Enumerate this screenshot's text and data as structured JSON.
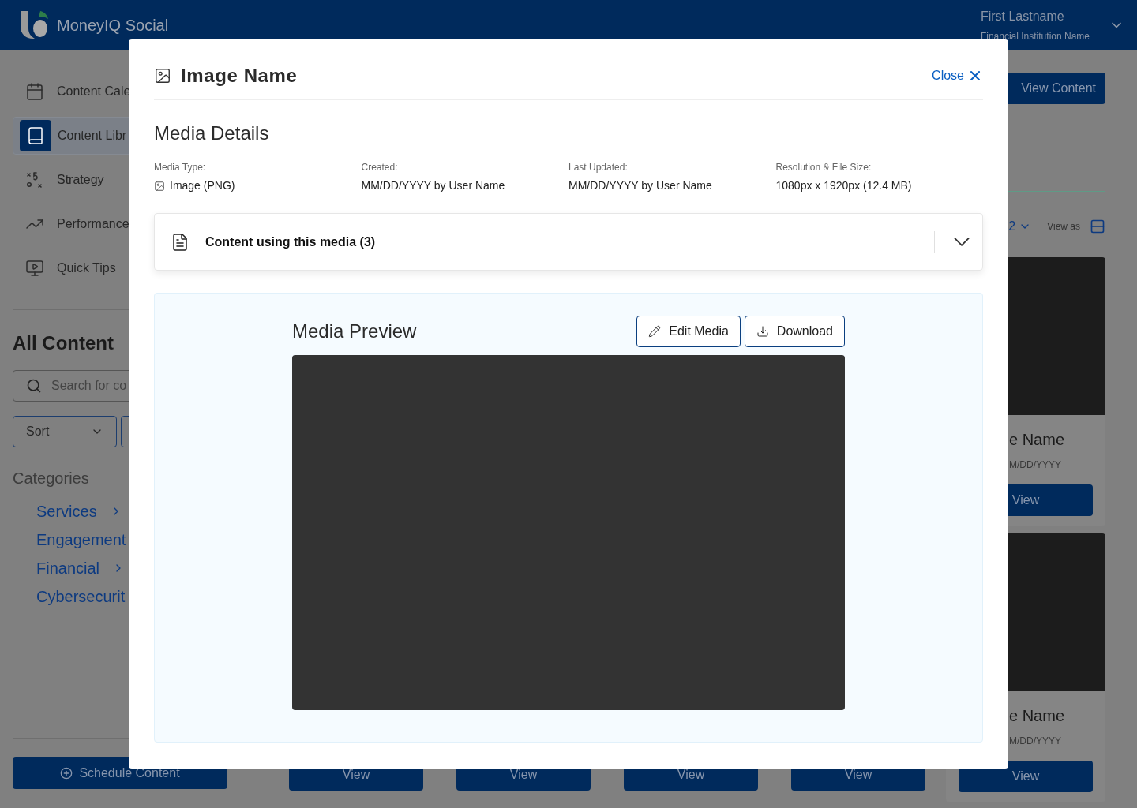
{
  "header": {
    "app_name": "MoneyIQ Social",
    "user_name": "First Lastname",
    "institution": "Financial Institution Name"
  },
  "sidebar": {
    "items": [
      {
        "label": "Content Cale",
        "kind": "calendar",
        "selected": false
      },
      {
        "label": "Content Libr",
        "kind": "library",
        "selected": true
      },
      {
        "label": "Strategy",
        "kind": "strategy",
        "selected": false
      },
      {
        "label": "Performance",
        "kind": "performance",
        "selected": false
      },
      {
        "label": "Quick Tips",
        "kind": "tips",
        "selected": false
      }
    ],
    "section_title": "All Content",
    "search": {
      "placeholder": "Search for co"
    },
    "sort": {
      "value": "Sort"
    },
    "categories_title": "Categories",
    "categories": [
      {
        "label": "Services",
        "has_submenu": true
      },
      {
        "label": "Engagement",
        "has_submenu": false
      },
      {
        "label": "Financial",
        "has_submenu": true
      },
      {
        "label": "Cybersecurit",
        "has_submenu": false
      }
    ],
    "schedule_button": "Schedule Content"
  },
  "main": {
    "view_content_button": "View Content",
    "page_selector": "2",
    "view_as_label": "View as",
    "cards": [
      {
        "name": "e Name",
        "date": "M/DD/YYYY",
        "button": "View"
      },
      {
        "name": "e Name",
        "date": "M/DD/YYYY",
        "button": "View"
      }
    ],
    "bottom_buttons": [
      "View",
      "View",
      "View",
      "View"
    ]
  },
  "modal": {
    "title": "Image Name",
    "close": "Close",
    "section_title": "Media Details",
    "details": [
      {
        "label": "Media Type:",
        "value": "Image (PNG)",
        "kind": "type"
      },
      {
        "label": "Created:",
        "value": "MM/DD/YYYY by User Name",
        "kind": "text"
      },
      {
        "label": "Last Updated:",
        "value": "MM/DD/YYYY by User Name",
        "kind": "text"
      },
      {
        "label": "Resolution & File Size:",
        "value": "1080px x 1920px (12.4 MB)",
        "kind": "text"
      }
    ],
    "accordion": {
      "title": "Content using this media (3)",
      "expanded": false
    },
    "preview": {
      "title": "Media Preview",
      "buttons": [
        {
          "label": "Edit Media",
          "kind": "edit"
        },
        {
          "label": "Download",
          "kind": "download"
        }
      ]
    }
  }
}
